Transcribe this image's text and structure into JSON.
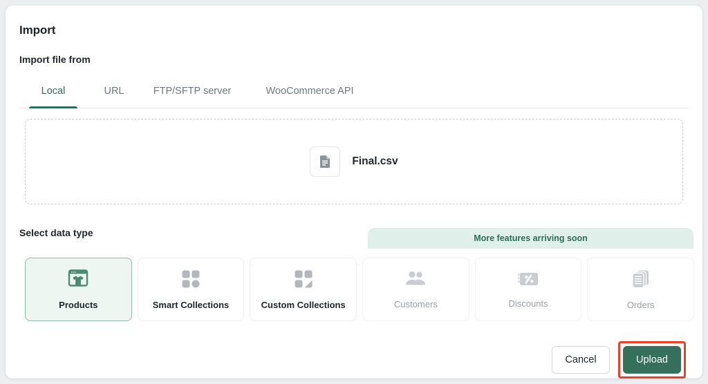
{
  "dialog": {
    "title": "Import",
    "source_label": "Import file from"
  },
  "tabs": [
    {
      "label": "Local",
      "active": true
    },
    {
      "label": "URL",
      "active": false
    },
    {
      "label": "FTP/SFTP server",
      "active": false
    },
    {
      "label": "WooCommerce API",
      "active": false
    }
  ],
  "dropzone": {
    "file_icon": "file-document-icon",
    "file_name": "Final.csv"
  },
  "data_type": {
    "section_label": "Select data type",
    "banner_label": "More features arriving soon",
    "cards": [
      {
        "label": "Products",
        "icon": "product-window-shirt-icon",
        "state": "selected"
      },
      {
        "label": "Smart Collections",
        "icon": "smart-collections-grid-icon",
        "state": "enabled"
      },
      {
        "label": "Custom Collections",
        "icon": "custom-collections-grid-icon",
        "state": "enabled"
      },
      {
        "label": "Customers",
        "icon": "customers-people-icon",
        "state": "disabled"
      },
      {
        "label": "Discounts",
        "icon": "discount-percent-tag-icon",
        "state": "disabled"
      },
      {
        "label": "Orders",
        "icon": "orders-documents-icon",
        "state": "disabled"
      }
    ]
  },
  "footer": {
    "cancel_label": "Cancel",
    "upload_label": "Upload"
  },
  "colors": {
    "accent_green": "#2f6d58",
    "button_green": "#35705c",
    "selected_card_bg": "#eef6f1",
    "banner_bg": "#e1efea",
    "annotation_red": "#e8402a",
    "disabled_gray": "#9aa0a6"
  }
}
